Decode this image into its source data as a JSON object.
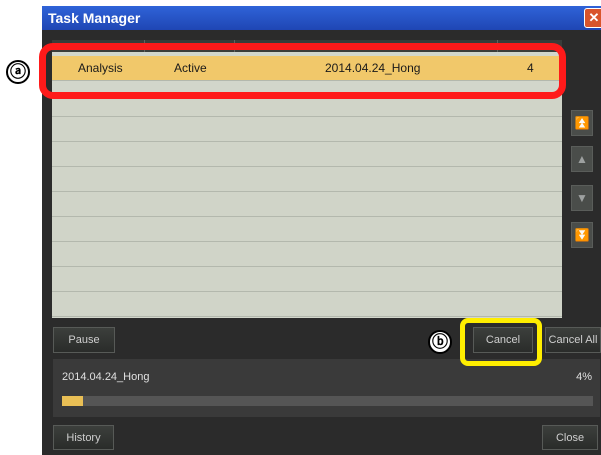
{
  "window": {
    "title": "Task Manager"
  },
  "table": {
    "rows": [
      {
        "name": "Analysis",
        "status": "Active",
        "task": "2014.04.24_Hong",
        "count": "4"
      }
    ]
  },
  "annotations": {
    "a": "ⓐ",
    "b": "ⓑ"
  },
  "nav_icons": [
    "move-top-icon",
    "move-up-icon",
    "move-down-icon",
    "move-bottom-icon"
  ],
  "buttons": {
    "pause": "Pause",
    "cancel": "Cancel",
    "cancel_all": "Cancel All",
    "history": "History",
    "close": "Close"
  },
  "progress": {
    "task_name": "2014.04.24_Hong",
    "percent_label": "4%",
    "fraction": 0.04
  },
  "colors": {
    "selected_row": "#f1c86a",
    "highlight_a": "#ff1a1a",
    "highlight_b": "#ffee00",
    "progress_fill": "#e9bf55"
  }
}
